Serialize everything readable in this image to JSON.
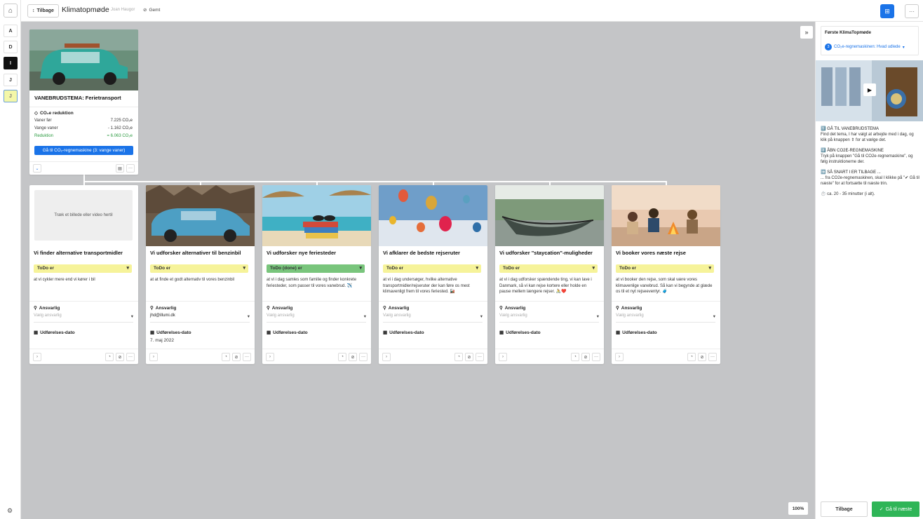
{
  "rail": {
    "items": [
      "A",
      "D",
      "I",
      "J",
      "J"
    ]
  },
  "topbar": {
    "back_label": "Tilbage",
    "title": "Klimatopmøde",
    "user": "Joan Haugor",
    "saved": "Gemt"
  },
  "zoom": "100%",
  "top_card": {
    "title": "VANEBRUDSTEMA: Ferietransport",
    "co2_header": "CO₂e reduktion",
    "rows": [
      {
        "label": "Vaner før",
        "value": "7.225 CO₂e"
      },
      {
        "label": "Vange vaner",
        "value": "- 1.162 CO₂e"
      },
      {
        "label": "Reduktion",
        "value": "= 6.063 CO₂e"
      }
    ],
    "button": "Gå til CO₂-regnemaskine (3: vange vaner)"
  },
  "cards": [
    {
      "title": "Vi finder alternative transportmidler",
      "upload_text": "Træk et billede eller video hertil",
      "status": "ToDo er",
      "done": false,
      "desc": "at vi cykler mere end vi kører i bil",
      "resp_label": "Ansvarlig",
      "resp_value": "Vælg ansvarlig",
      "resp_filled": false,
      "date_label": "Udførelses-dato",
      "date_value": ""
    },
    {
      "title": "Vi udforsker alternativer til benzinbil",
      "status": "ToDo er",
      "done": false,
      "desc": "at at finde et godt alternativ til vores benzinbil",
      "resp_label": "Ansvarlig",
      "resp_value": "jhd@illumi.dk",
      "resp_filled": true,
      "date_label": "Udførelses-dato",
      "date_value": "7. maj 2022"
    },
    {
      "title": "Vi udforsker nye feriesteder",
      "status": "ToDo (done) er",
      "done": true,
      "desc": "at vi i dag samles som familie og finder konkrete feriesteder, som passer til vores vanebrud. ✈️",
      "resp_label": "Ansvarlig",
      "resp_value": "Vælg ansvarlig",
      "resp_filled": false,
      "date_label": "Udførelses-dato",
      "date_value": ""
    },
    {
      "title": "Vi afklarer de bedste rejseruter",
      "status": "ToDo er",
      "done": false,
      "desc": "at vi i dag undersøger, hvilke alternative transportmidler/rejseruter der kan føre os mest klimavenligt frem til vores feriested. 🚂",
      "resp_label": "Ansvarlig",
      "resp_value": "Vælg ansvarlig",
      "resp_filled": false,
      "date_label": "Udførelses-dato",
      "date_value": ""
    },
    {
      "title": "Vi udforsker \"staycation\"-muligheder",
      "status": "ToDo er",
      "done": false,
      "desc": "at vi i dag udforsker spændende ting, vi kan lave i Danmark, så vi kan rejse kortere eller holde en pause mellem længere rejser. 🚴❤️",
      "resp_label": "Ansvarlig",
      "resp_value": "Vælg ansvarlig",
      "resp_filled": false,
      "date_label": "Udførelses-dato",
      "date_value": ""
    },
    {
      "title": "Vi booker vores næste rejse",
      "status": "ToDo er",
      "done": false,
      "desc": "at vi booker den rejse, som skal være vores klimavenlige vanebrud. Så kan vi begynde at glæde os til et nyt rejseeventyr. 🧳",
      "resp_label": "Ansvarlig",
      "resp_value": "Vælg ansvarlig",
      "resp_filled": false,
      "date_label": "Udførelses-dato",
      "date_value": ""
    }
  ],
  "panel": {
    "header": "Første KlimaTopmøde",
    "step_num": "3",
    "step_label": "CO₂e-regnemaskinen: Hvad udlede",
    "instructions": [
      {
        "head": "1️⃣ GÅ TIL VANEBRUDSTEMA",
        "body": "Find det tema, I har valgt at arbejde med i dag, og klik på knappen ⇕ for at vælge det."
      },
      {
        "head": "2️⃣ ÅBN CO2E-REGNEMASKINE",
        "body": "Tryk på knappen \"Gå til CO2e-regnemaskine\", og følg instruktionerne der."
      },
      {
        "head": "➡️ SÅ SNART I ER TILBAGE ...",
        "body": "... fra CO2e-regnemaskinen, skal I klikke på \"✔ Gå til næste\" for at fortsætte til næste trin."
      },
      {
        "head": "",
        "body": "⏱️ ca. 20 - 35 minutter (i alt)."
      }
    ],
    "back": "Tilbage",
    "next": "Gå til næste"
  }
}
